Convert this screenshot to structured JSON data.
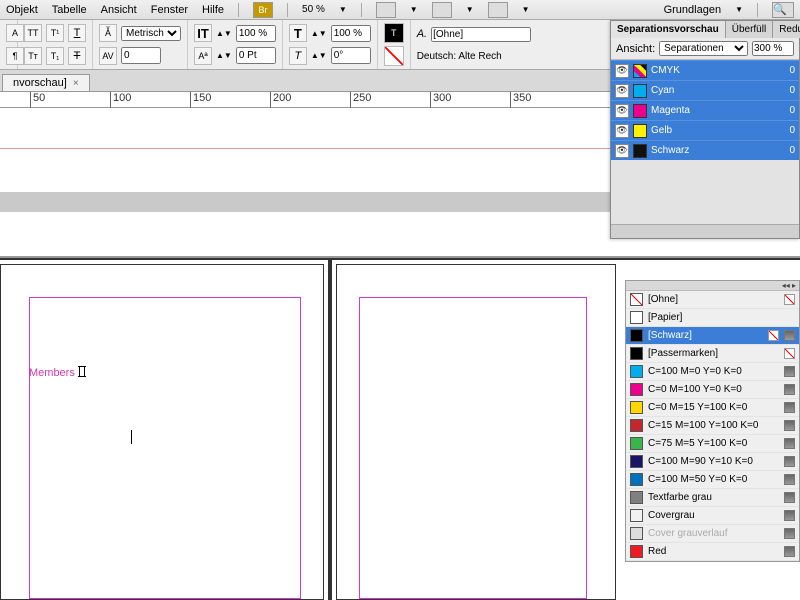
{
  "menu": {
    "items": [
      "Objekt",
      "Tabelle",
      "Ansicht",
      "Fenster",
      "Hilfe"
    ],
    "zoom": "50 %",
    "workspace": "Grundlagen"
  },
  "toolbar": {
    "metrics": "Metrisch",
    "pct1": "100 %",
    "pct2": "100 %",
    "pt": "0 Pt",
    "deg": "0°",
    "charstyle": "[Ohne]",
    "lang": "Deutsch: Alte Rech"
  },
  "tab": {
    "name": "nvorschau]"
  },
  "ruler": [
    "50",
    "100",
    "150",
    "200",
    "250",
    "300",
    "350"
  ],
  "doc": {
    "text": "Members"
  },
  "sep_panel": {
    "tabs": [
      "Separationsvorschau",
      "Überfüll",
      "Reduzie"
    ],
    "view_label": "Ansicht:",
    "view": "Separationen",
    "pct": "300 %",
    "rows": [
      {
        "name": "CMYK",
        "val": "0",
        "color": "linear-gradient(45deg,#00aeef 0 25%,#ec008c 25% 50%,#fff200 50% 75%,#111 75% 100%)"
      },
      {
        "name": "Cyan",
        "val": "0",
        "color": "#00aeef"
      },
      {
        "name": "Magenta",
        "val": "0",
        "color": "#ec008c"
      },
      {
        "name": "Gelb",
        "val": "0",
        "color": "#fff200"
      },
      {
        "name": "Schwarz",
        "val": "0",
        "color": "#111"
      }
    ]
  },
  "swatches": [
    {
      "label": "[Ohne]",
      "color": "none",
      "end": "x"
    },
    {
      "label": "[Papier]",
      "color": "#fff",
      "end": ""
    },
    {
      "label": "[Schwarz]",
      "color": "#000",
      "end": "xg",
      "sel": true
    },
    {
      "label": "[Passermarken]",
      "color": "#000",
      "end": "x"
    },
    {
      "label": "C=100 M=0 Y=0 K=0",
      "color": "#00aeef",
      "end": "g"
    },
    {
      "label": "C=0 M=100 Y=0 K=0",
      "color": "#ec008c",
      "end": "g"
    },
    {
      "label": "C=0 M=15 Y=100 K=0",
      "color": "#ffd700",
      "end": "g"
    },
    {
      "label": "C=15 M=100 Y=100 K=0",
      "color": "#c1272d",
      "end": "g"
    },
    {
      "label": "C=75 M=5 Y=100 K=0",
      "color": "#39b54a",
      "end": "g"
    },
    {
      "label": "C=100 M=90 Y=10 K=0",
      "color": "#1b1464",
      "end": "g"
    },
    {
      "label": "C=100 M=50 Y=0 K=0",
      "color": "#0071bc",
      "end": "g"
    },
    {
      "label": "Textfarbe grau",
      "color": "#808080",
      "end": "g"
    },
    {
      "label": "Covergrau",
      "color": "#f2f2f2",
      "end": "g"
    },
    {
      "label": "Cover grauverlauf",
      "color": "#ddd",
      "end": "g",
      "dis": true
    },
    {
      "label": "Red",
      "color": "#ed1c24",
      "end": "g"
    }
  ]
}
